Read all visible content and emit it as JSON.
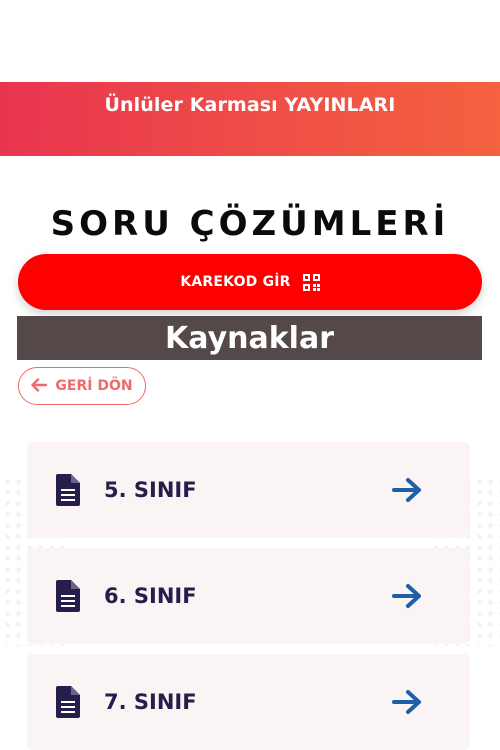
{
  "header": {
    "brand_title": "Ünlüler Karması YAYINLARI"
  },
  "main": {
    "page_heading": "SORU ÇÖZÜMLERİ",
    "qr_button_label": "KAREKOD GİR",
    "section_title": "Kaynaklar",
    "back_button_label": "GERİ DÖN",
    "items": [
      {
        "label": "5. SINIF"
      },
      {
        "label": "6. SINIF"
      },
      {
        "label": "7. SINIF"
      }
    ]
  },
  "icons": {
    "qr": "qr-code-icon",
    "back": "arrow-left-icon",
    "item": "document-icon",
    "go": "arrow-right-icon"
  },
  "colors": {
    "brand_gradient_start": "#e8354f",
    "brand_gradient_end": "#f4623f",
    "primary_red": "#ff0000",
    "banner_bg": "#554848",
    "back_outline": "#ef6b6b",
    "item_bg": "#faf4f4",
    "item_text": "#261e4a",
    "arrow": "#1f5fa8"
  }
}
